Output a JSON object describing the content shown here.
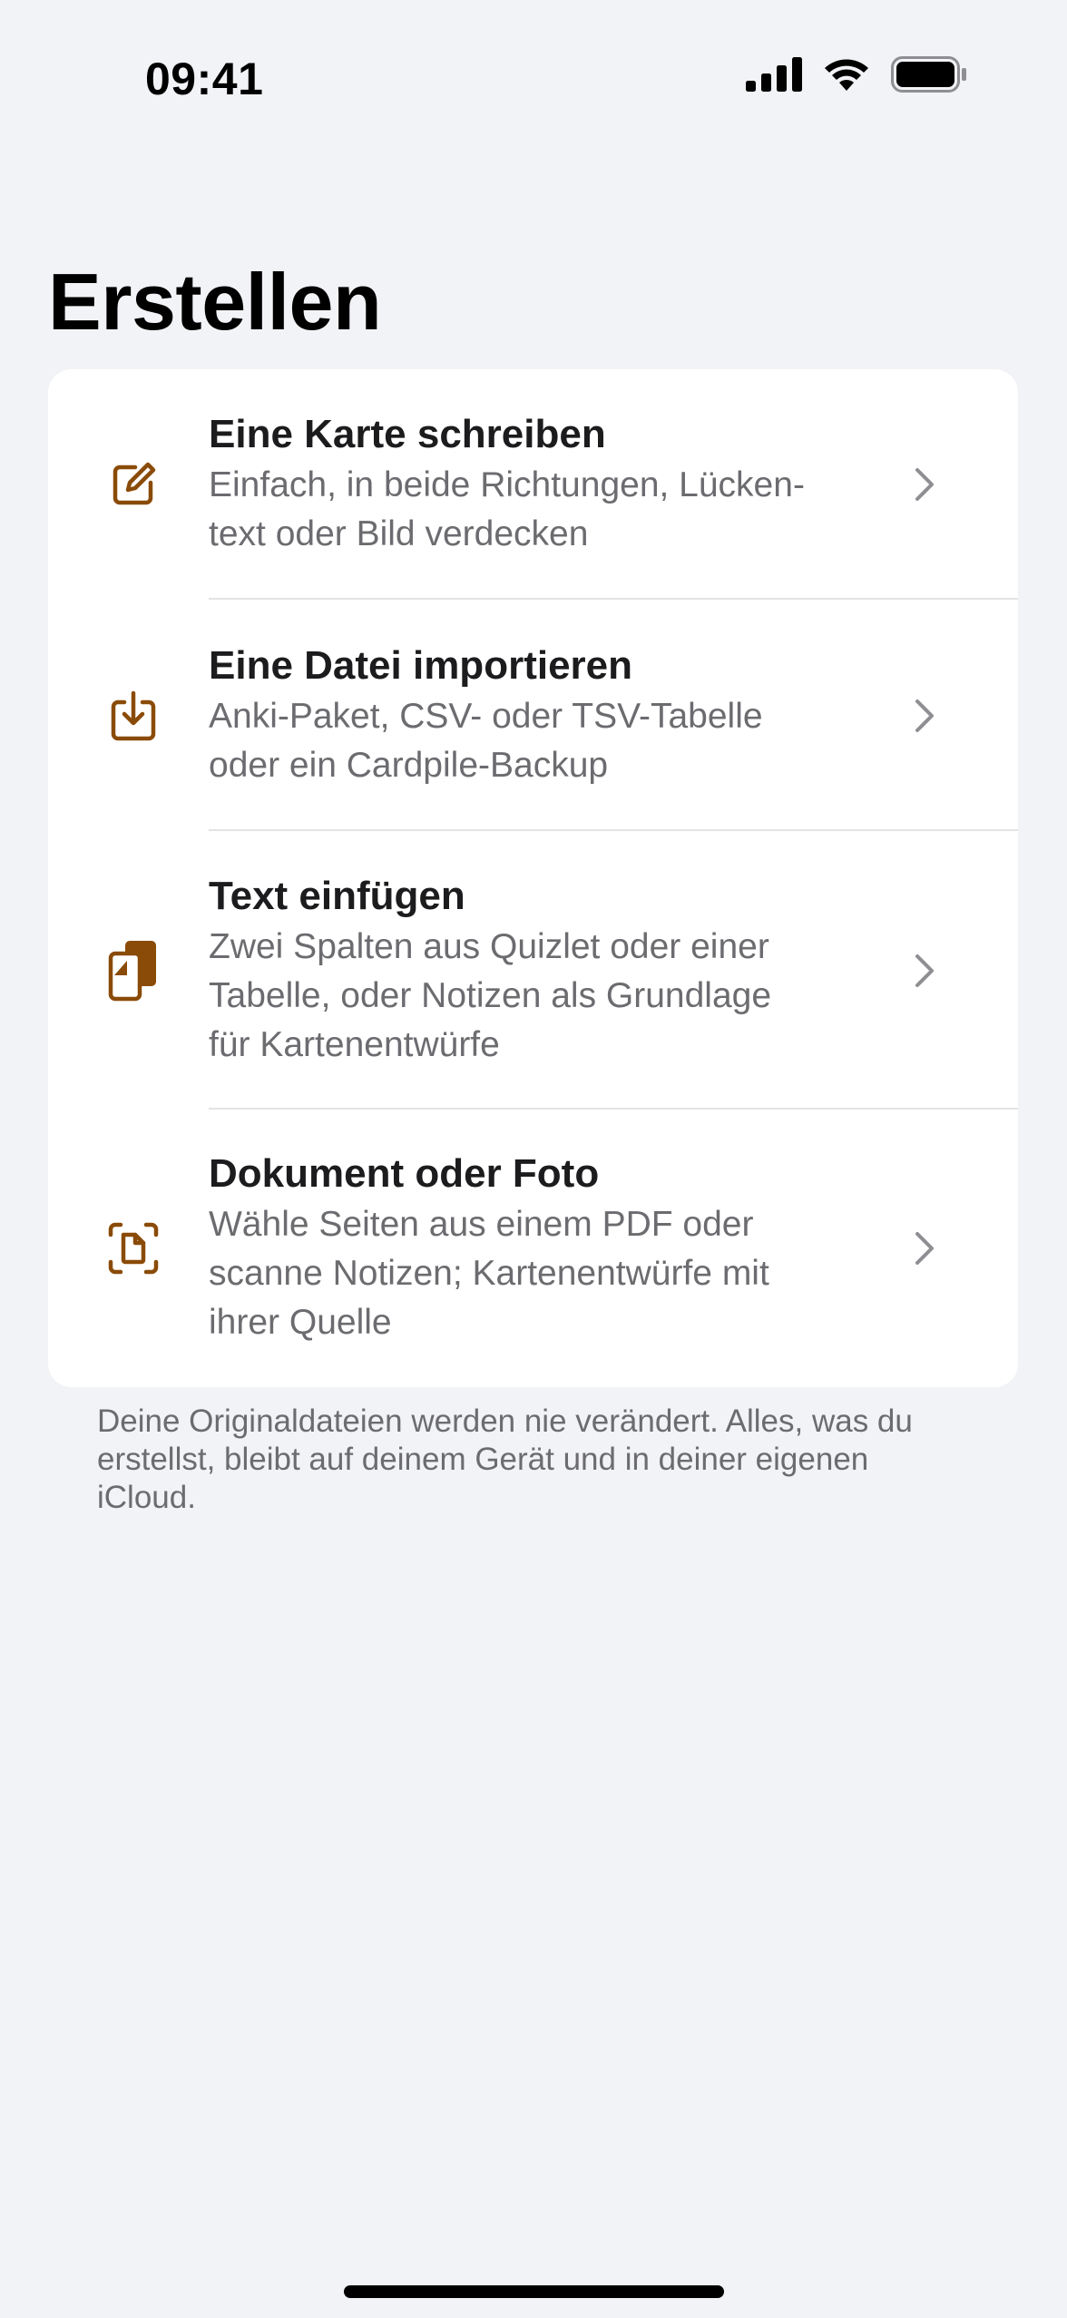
{
  "status_bar": {
    "time": "09:41",
    "icons": [
      "cellular-signal-icon",
      "wifi-icon",
      "battery-icon"
    ]
  },
  "page": {
    "title": "Erstellen"
  },
  "colors": {
    "accent": "#8a4b08",
    "background": "#f2f3f6",
    "card": "#ffffff",
    "secondary_text": "#6c6c70"
  },
  "options": [
    {
      "title": "Eine Karte schreiben",
      "desc_lines": [
        "Einfach, in beide Richtungen, Lücken-",
        "text oder Bild verdecken"
      ],
      "icon": "compose-icon"
    },
    {
      "title": "Eine Datei importieren",
      "desc_lines": [
        "Anki-Paket, CSV- oder TSV-Tabelle",
        "oder ein Cardpile-Backup"
      ],
      "icon": "import-tray-icon"
    },
    {
      "title": "Text einfügen",
      "desc_lines": [
        "Zwei Spalten aus Quizlet oder einer",
        "Tabelle, oder Notizen als Grundlage",
        "für Kartenentwürfe"
      ],
      "icon": "clipboard-paste-icon"
    },
    {
      "title": "Dokument oder Foto",
      "desc_lines": [
        "Wähle Seiten aus einem PDF oder",
        "scanne Notizen; Kartenentwürfe mit",
        "ihrer Quelle"
      ],
      "icon": "document-scan-icon"
    }
  ],
  "footer": {
    "lines": [
      "Deine Originaldateien werden nie verändert. Alles, was du",
      "erstellst, bleibt auf deinem Gerät und in deiner eigenen",
      "iCloud."
    ]
  }
}
